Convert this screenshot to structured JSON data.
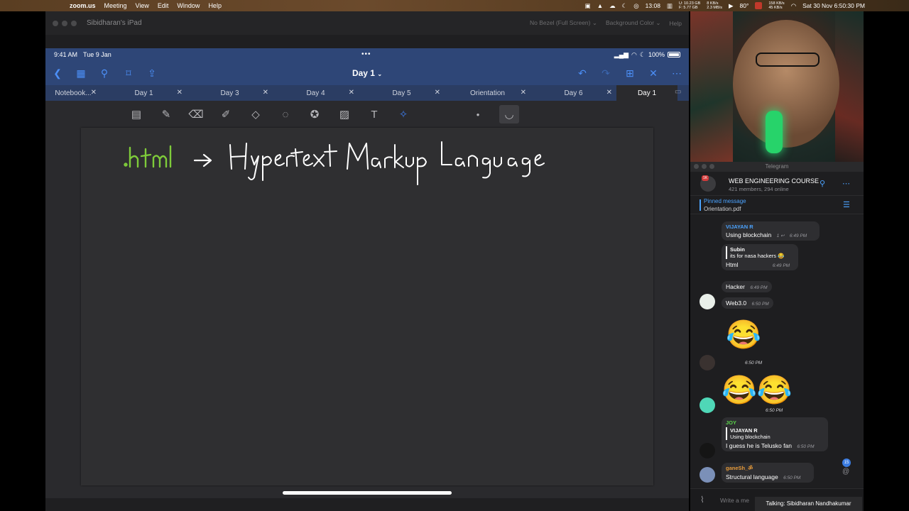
{
  "menubar": {
    "app": "zoom.us",
    "items": [
      "Meeting",
      "View",
      "Edit",
      "Window",
      "Help"
    ],
    "timer": "13:08",
    "mem": "U: 10.23 GB\nF: 5.77 GB",
    "net": "8 KB/s\n2.3 MB/s",
    "temp": "80°",
    "net2": "158 KB/s\n45 KB/s",
    "datetime": "Sat 30 Nov  6:50:30 PM"
  },
  "zoom": {
    "window_title": "Sibidharan's iPad",
    "bezel_option": "No Bezel (Full Screen)",
    "bg_option": "Background Color",
    "help": "Help"
  },
  "ipad": {
    "time": "9:41 AM",
    "date": "Tue 9 Jan",
    "battery": "100%",
    "doc_title": "Day 1",
    "tabs": [
      "Notebook...",
      "Day 1",
      "Day 3",
      "Day 4",
      "Day 5",
      "Orientation",
      "Day 6",
      "Day 1"
    ],
    "handwriting": {
      "extension": ".html",
      "arrow": "→",
      "phrase": "Hypertext Markup Language"
    }
  },
  "telegram": {
    "window_title": "Telegram",
    "group_name": "WEB ENGINEERING COURSE",
    "group_sub": "421 members, 294 online",
    "badge": "1K",
    "pinned_label": "Pinned message",
    "pinned_text": "Orientation.pdf",
    "messages": {
      "m1_sender": "VIJAYAN R",
      "m1_text": "Using blockchain",
      "m1_meta": "1",
      "m1_time": "6:49 PM",
      "m2_quote_sender": "Subin",
      "m2_quote_text": "its for nasa hackers 😂",
      "m2_text": "Html",
      "m2_time": "6:49 PM",
      "m3_text": "Hacker",
      "m3_time": "6:49 PM",
      "m4_text": "Web3.0",
      "m4_time": "6:50 PM",
      "e1": "😂",
      "e1_time": "6:50 PM",
      "e2": "😂😂",
      "e2_time": "6:50 PM",
      "m5_sender": "JOY",
      "m5_quote_sender": "VIJAYAN R",
      "m5_quote_text": "Using blockchain",
      "m5_text": "I guess he is Telusko fan",
      "m5_time": "6:50 PM",
      "m6_sender": "ganeSh_ॐ",
      "m6_text": "Structural language",
      "m6_time": "6:50 PM"
    },
    "unread_count": "15",
    "input_placeholder": "Write a me",
    "talking": "Talking: Sibidharan Nandhakumar"
  },
  "colors": {
    "ipad_nav": "#2e4677",
    "accent": "#4c8ff7",
    "ink_green": "#7ecb3a",
    "telegram_accent": "#4ba3ff"
  }
}
